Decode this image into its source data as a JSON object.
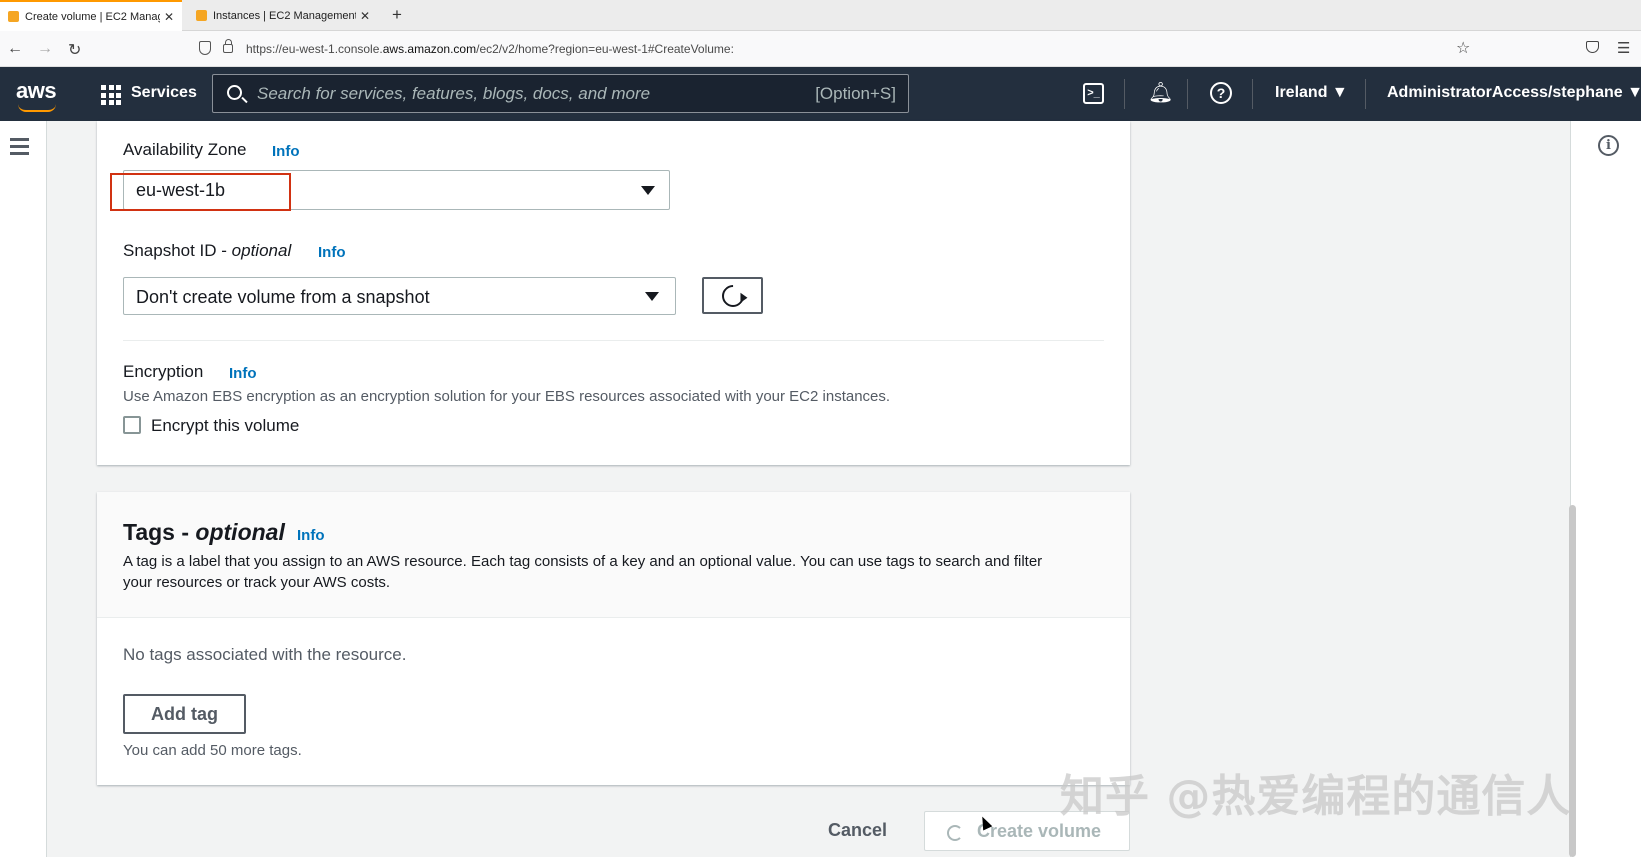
{
  "browser": {
    "tabs": [
      {
        "title": "Create volume | EC2 Manageme"
      },
      {
        "title": "Instances | EC2 Management C"
      }
    ],
    "url_prefix": "https://eu-west-1.console.",
    "url_domain": "aws.amazon.com",
    "url_suffix": "/ec2/v2/home?region=eu-west-1#CreateVolume:"
  },
  "aws_nav": {
    "logo": "aws",
    "services_label": "Services",
    "search_placeholder": "Search for services, features, blogs, docs, and more",
    "search_shortcut": "[Option+S]",
    "region": "Ireland",
    "account": "AdministratorAccess/stephane"
  },
  "volume_settings": {
    "az_label": "Availability Zone",
    "az_info": "Info",
    "az_value": "eu-west-1b",
    "snapshot_label": "Snapshot ID - ",
    "snapshot_optional": "optional",
    "snapshot_info": "Info",
    "snapshot_value": "Don't create volume from a snapshot",
    "encryption_label": "Encryption",
    "encryption_info": "Info",
    "encryption_desc": "Use Amazon EBS encryption as an encryption solution for your EBS resources associated with your EC2 instances.",
    "encrypt_checkbox_label": "Encrypt this volume",
    "encrypt_checked": false
  },
  "tags": {
    "title": "Tags - ",
    "title_optional": "optional",
    "info": "Info",
    "desc_line1": "A tag is a label that you assign to an AWS resource. Each tag consists of a key and an optional value. You can use tags to search and filter",
    "desc_line2": "your resources or track your AWS costs.",
    "empty_text": "No tags associated with the resource.",
    "add_button": "Add tag",
    "limit_text": "You can add 50 more tags."
  },
  "footer": {
    "cancel": "Cancel",
    "create": "Create volume"
  },
  "watermark": "知乎 @热爱编程的通信人",
  "colors": {
    "aws_nav_bg": "#232f3e",
    "aws_orange": "#ff9900",
    "link_blue": "#0073bb",
    "highlight_red": "#d13212"
  }
}
